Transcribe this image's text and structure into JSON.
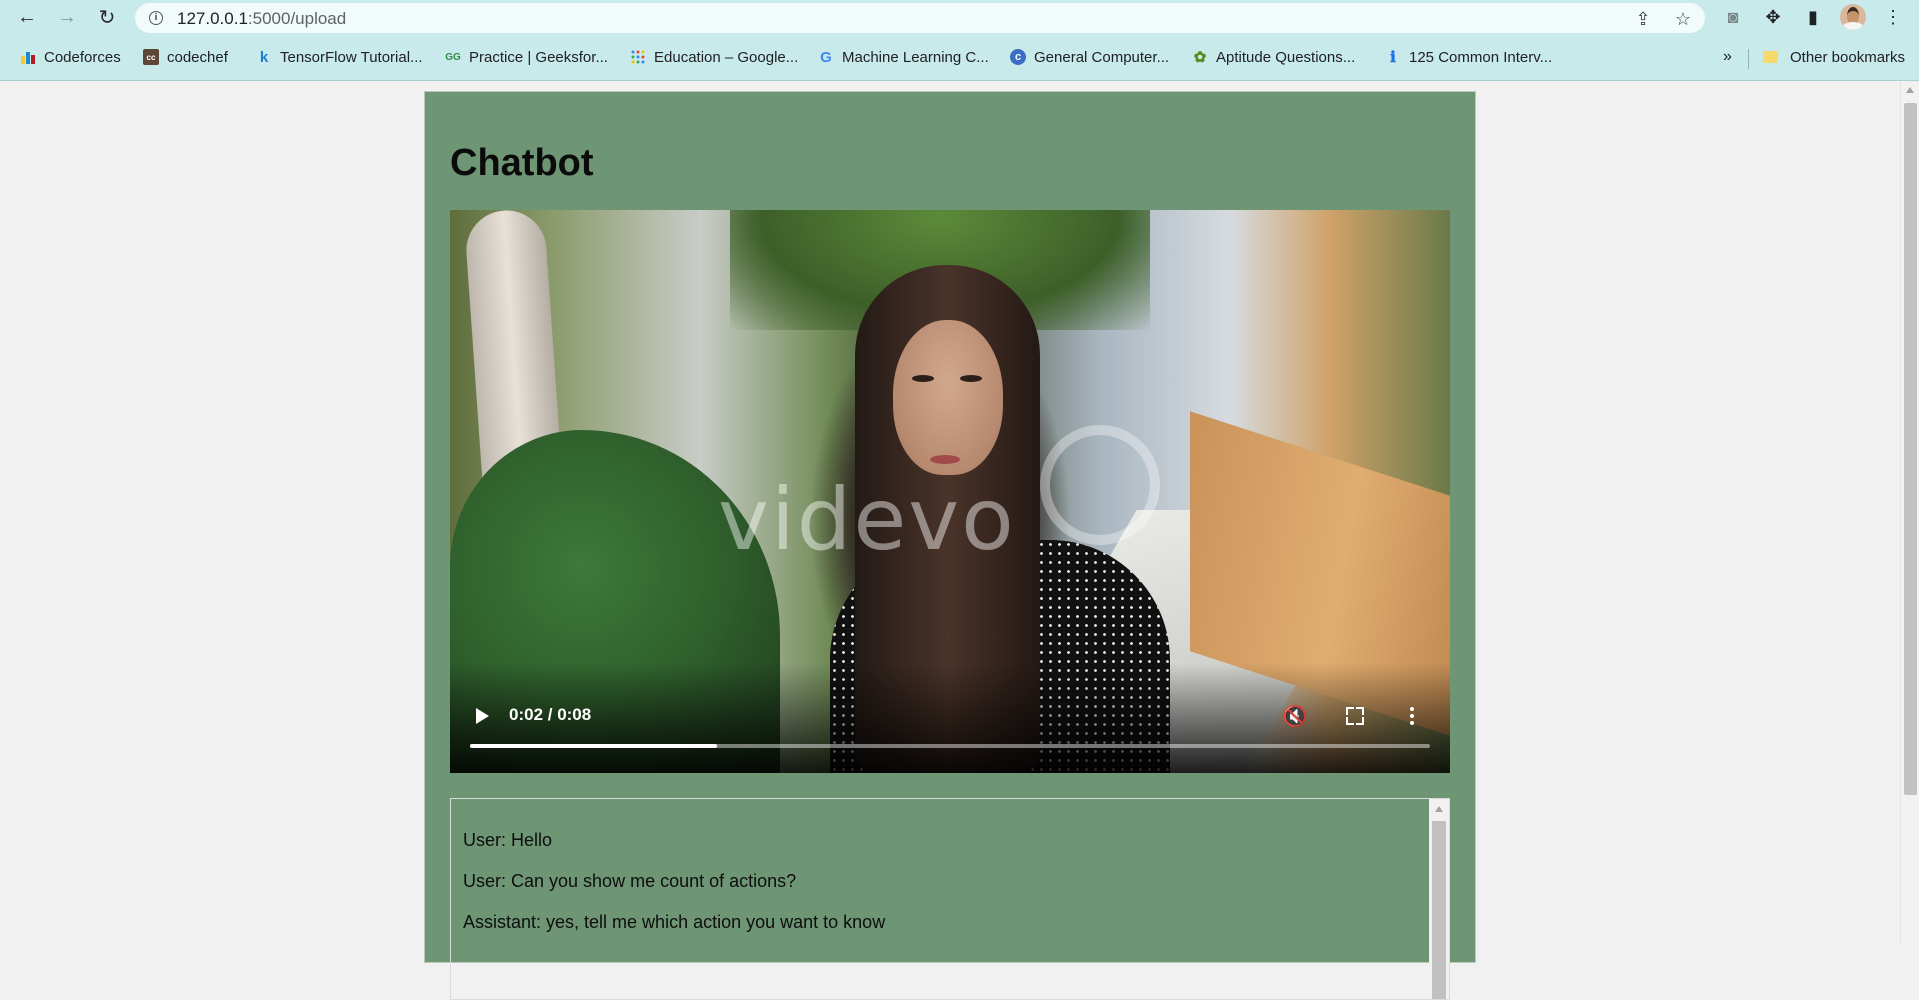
{
  "browser": {
    "url_host": "127.0.0.1",
    "url_path": ":5000/upload",
    "bookmarks": [
      {
        "label": "Codeforces",
        "icon": "codeforces-icon"
      },
      {
        "label": "codechef",
        "icon": "codechef-icon"
      },
      {
        "label": "TensorFlow Tutorial...",
        "icon": "k-icon"
      },
      {
        "label": "Practice | Geeksfor...",
        "icon": "geeksforgeeks-icon"
      },
      {
        "label": "Education – Google...",
        "icon": "google-education-icon"
      },
      {
        "label": "Machine Learning C...",
        "icon": "google-icon"
      },
      {
        "label": "General Computer...",
        "icon": "c-icon"
      },
      {
        "label": "Aptitude Questions...",
        "icon": "aptitude-icon"
      },
      {
        "label": "125 Common Interv...",
        "icon": "info-icon"
      }
    ],
    "more_bookmarks": "»",
    "other_bookmarks": "Other bookmarks"
  },
  "page": {
    "title": "Chatbot"
  },
  "video": {
    "time": "0:02 / 0:08",
    "progress": 0.257,
    "watermark": "videvo"
  },
  "chat": {
    "messages": [
      "User: Hello",
      "User: Can you show me count of actions?",
      "Assistant: yes, tell me which action you want to know"
    ]
  }
}
